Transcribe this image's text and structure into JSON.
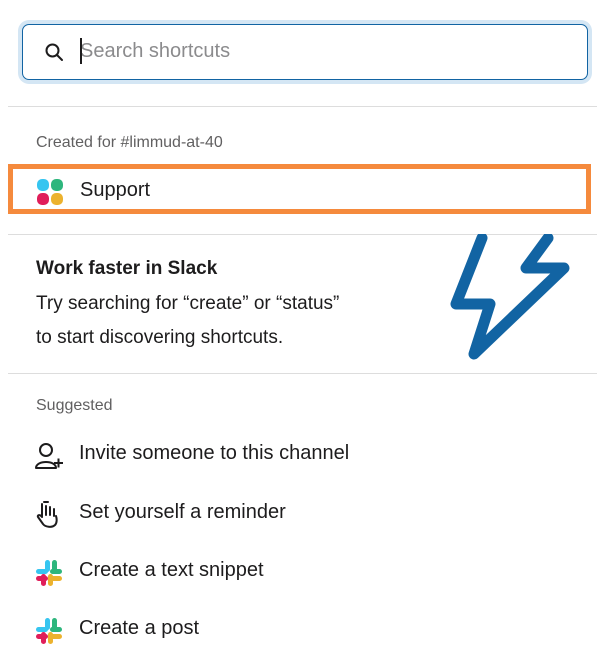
{
  "search": {
    "placeholder": "Search shortcuts",
    "value": ""
  },
  "created_section": {
    "label": "Created for #limmud-at-40",
    "items": [
      {
        "label": "Support",
        "icon": "workflow-app-icon"
      }
    ]
  },
  "tip": {
    "title": "Work faster in Slack",
    "line1": "Try searching for “create” or “status”",
    "line2": "to start discovering shortcuts.",
    "icon": "lightning-bolt-icon"
  },
  "suggested_section": {
    "label": "Suggested",
    "items": [
      {
        "label": "Invite someone to this channel",
        "icon": "add-person-icon"
      },
      {
        "label": "Set yourself a reminder",
        "icon": "reminder-hand-icon"
      },
      {
        "label": "Create a text snippet",
        "icon": "slack-logo-icon"
      },
      {
        "label": "Create a post",
        "icon": "slack-logo-icon"
      }
    ]
  },
  "colors": {
    "focus_border": "#1264a3",
    "highlight": "#f58a3d",
    "bolt_blue": "#1264a3",
    "divider": "#dddddd",
    "muted_text": "#616061"
  }
}
